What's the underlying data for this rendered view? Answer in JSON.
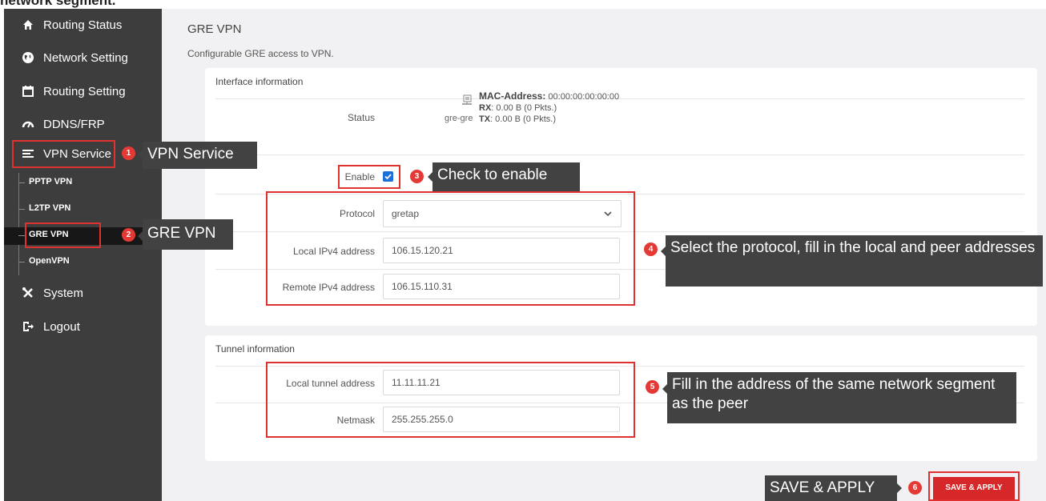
{
  "document": {
    "heading": "network segment."
  },
  "sidebar": {
    "items": [
      {
        "label": "Routing Status",
        "icon": "home-icon"
      },
      {
        "label": "Network Setting",
        "icon": "globe-icon"
      },
      {
        "label": "Routing Setting",
        "icon": "calendar-icon"
      },
      {
        "label": "DDNS/FRP",
        "icon": "gauge-icon"
      },
      {
        "label": "VPN Service",
        "icon": "list-icon"
      },
      {
        "label": "System",
        "icon": "tools-icon"
      },
      {
        "label": "Logout",
        "icon": "logout-icon"
      }
    ],
    "vpn_subitems": [
      "PPTP VPN",
      "L2TP VPN",
      "GRE VPN",
      "OpenVPN"
    ]
  },
  "page": {
    "title": "GRE VPN",
    "description": "Configurable GRE access to VPN."
  },
  "interface_card": {
    "title": "Interface information",
    "status_label": "Status",
    "device": "gre-gre",
    "mac_key": "MAC-Address:",
    "mac_value": "00:00:00:00:00:00",
    "rx_key": "RX",
    "rx_value": ": 0.00 B (0 Pkts.)",
    "tx_key": "TX",
    "tx_value": ": 0.00 B (0 Pkts.)",
    "enable_label": "Enable",
    "enable_checked": true,
    "protocol_label": "Protocol",
    "protocol_value": "gretap",
    "local_ipv4_label": "Local IPv4 address",
    "local_ipv4_value": "106.15.120.21",
    "remote_ipv4_label": "Remote IPv4 address",
    "remote_ipv4_value": "106.15.110.31"
  },
  "tunnel_card": {
    "title": "Tunnel information",
    "local_tunnel_label": "Local tunnel address",
    "local_tunnel_value": "11.11.11.21",
    "netmask_label": "Netmask",
    "netmask_value": "255.255.255.0"
  },
  "save_button": "SAVE & APPLY",
  "annotations": {
    "step1": {
      "num": "1",
      "text": "VPN Service"
    },
    "step2": {
      "num": "2",
      "text": "GRE VPN"
    },
    "step3": {
      "num": "3",
      "text": "Check to enable"
    },
    "step4": {
      "num": "4",
      "text": "Select the protocol, fill in the local and peer addresses"
    },
    "step5": {
      "num": "5",
      "text": "Fill in the address of the same network segment as the peer"
    },
    "step6": {
      "num": "6",
      "text": "SAVE & APPLY"
    }
  },
  "colors": {
    "sidebar": "#3d3d3d",
    "accent_red": "#d62828",
    "annotation_red": "#e03131",
    "callout_bg": "#424242",
    "checkbox_blue": "#1e6fd9"
  }
}
